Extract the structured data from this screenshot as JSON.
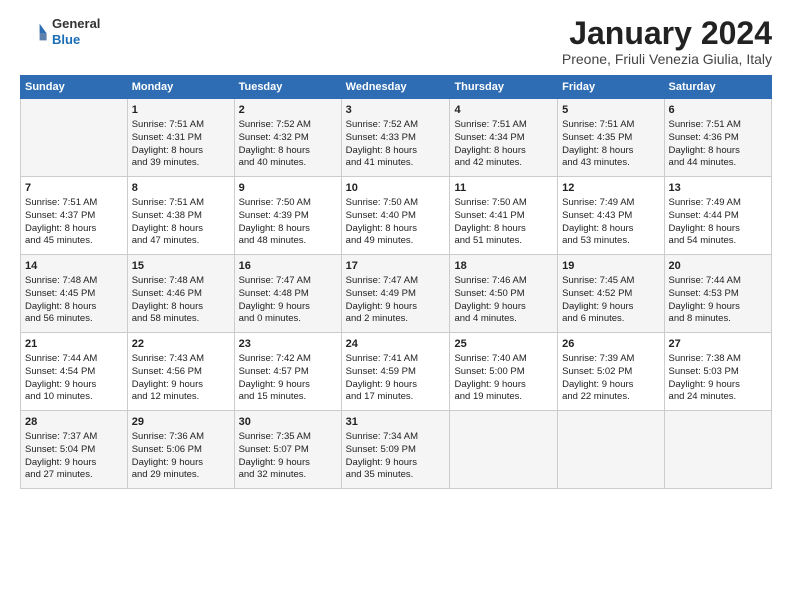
{
  "logo": {
    "general": "General",
    "blue": "Blue"
  },
  "title": "January 2024",
  "subtitle": "Preone, Friuli Venezia Giulia, Italy",
  "days_header": [
    "Sunday",
    "Monday",
    "Tuesday",
    "Wednesday",
    "Thursday",
    "Friday",
    "Saturday"
  ],
  "weeks": [
    [
      {
        "day": "",
        "content": ""
      },
      {
        "day": "1",
        "content": "Sunrise: 7:51 AM\nSunset: 4:31 PM\nDaylight: 8 hours\nand 39 minutes."
      },
      {
        "day": "2",
        "content": "Sunrise: 7:52 AM\nSunset: 4:32 PM\nDaylight: 8 hours\nand 40 minutes."
      },
      {
        "day": "3",
        "content": "Sunrise: 7:52 AM\nSunset: 4:33 PM\nDaylight: 8 hours\nand 41 minutes."
      },
      {
        "day": "4",
        "content": "Sunrise: 7:51 AM\nSunset: 4:34 PM\nDaylight: 8 hours\nand 42 minutes."
      },
      {
        "day": "5",
        "content": "Sunrise: 7:51 AM\nSunset: 4:35 PM\nDaylight: 8 hours\nand 43 minutes."
      },
      {
        "day": "6",
        "content": "Sunrise: 7:51 AM\nSunset: 4:36 PM\nDaylight: 8 hours\nand 44 minutes."
      }
    ],
    [
      {
        "day": "7",
        "content": "Sunrise: 7:51 AM\nSunset: 4:37 PM\nDaylight: 8 hours\nand 45 minutes."
      },
      {
        "day": "8",
        "content": "Sunrise: 7:51 AM\nSunset: 4:38 PM\nDaylight: 8 hours\nand 47 minutes."
      },
      {
        "day": "9",
        "content": "Sunrise: 7:50 AM\nSunset: 4:39 PM\nDaylight: 8 hours\nand 48 minutes."
      },
      {
        "day": "10",
        "content": "Sunrise: 7:50 AM\nSunset: 4:40 PM\nDaylight: 8 hours\nand 49 minutes."
      },
      {
        "day": "11",
        "content": "Sunrise: 7:50 AM\nSunset: 4:41 PM\nDaylight: 8 hours\nand 51 minutes."
      },
      {
        "day": "12",
        "content": "Sunrise: 7:49 AM\nSunset: 4:43 PM\nDaylight: 8 hours\nand 53 minutes."
      },
      {
        "day": "13",
        "content": "Sunrise: 7:49 AM\nSunset: 4:44 PM\nDaylight: 8 hours\nand 54 minutes."
      }
    ],
    [
      {
        "day": "14",
        "content": "Sunrise: 7:48 AM\nSunset: 4:45 PM\nDaylight: 8 hours\nand 56 minutes."
      },
      {
        "day": "15",
        "content": "Sunrise: 7:48 AM\nSunset: 4:46 PM\nDaylight: 8 hours\nand 58 minutes."
      },
      {
        "day": "16",
        "content": "Sunrise: 7:47 AM\nSunset: 4:48 PM\nDaylight: 9 hours\nand 0 minutes."
      },
      {
        "day": "17",
        "content": "Sunrise: 7:47 AM\nSunset: 4:49 PM\nDaylight: 9 hours\nand 2 minutes."
      },
      {
        "day": "18",
        "content": "Sunrise: 7:46 AM\nSunset: 4:50 PM\nDaylight: 9 hours\nand 4 minutes."
      },
      {
        "day": "19",
        "content": "Sunrise: 7:45 AM\nSunset: 4:52 PM\nDaylight: 9 hours\nand 6 minutes."
      },
      {
        "day": "20",
        "content": "Sunrise: 7:44 AM\nSunset: 4:53 PM\nDaylight: 9 hours\nand 8 minutes."
      }
    ],
    [
      {
        "day": "21",
        "content": "Sunrise: 7:44 AM\nSunset: 4:54 PM\nDaylight: 9 hours\nand 10 minutes."
      },
      {
        "day": "22",
        "content": "Sunrise: 7:43 AM\nSunset: 4:56 PM\nDaylight: 9 hours\nand 12 minutes."
      },
      {
        "day": "23",
        "content": "Sunrise: 7:42 AM\nSunset: 4:57 PM\nDaylight: 9 hours\nand 15 minutes."
      },
      {
        "day": "24",
        "content": "Sunrise: 7:41 AM\nSunset: 4:59 PM\nDaylight: 9 hours\nand 17 minutes."
      },
      {
        "day": "25",
        "content": "Sunrise: 7:40 AM\nSunset: 5:00 PM\nDaylight: 9 hours\nand 19 minutes."
      },
      {
        "day": "26",
        "content": "Sunrise: 7:39 AM\nSunset: 5:02 PM\nDaylight: 9 hours\nand 22 minutes."
      },
      {
        "day": "27",
        "content": "Sunrise: 7:38 AM\nSunset: 5:03 PM\nDaylight: 9 hours\nand 24 minutes."
      }
    ],
    [
      {
        "day": "28",
        "content": "Sunrise: 7:37 AM\nSunset: 5:04 PM\nDaylight: 9 hours\nand 27 minutes."
      },
      {
        "day": "29",
        "content": "Sunrise: 7:36 AM\nSunset: 5:06 PM\nDaylight: 9 hours\nand 29 minutes."
      },
      {
        "day": "30",
        "content": "Sunrise: 7:35 AM\nSunset: 5:07 PM\nDaylight: 9 hours\nand 32 minutes."
      },
      {
        "day": "31",
        "content": "Sunrise: 7:34 AM\nSunset: 5:09 PM\nDaylight: 9 hours\nand 35 minutes."
      },
      {
        "day": "",
        "content": ""
      },
      {
        "day": "",
        "content": ""
      },
      {
        "day": "",
        "content": ""
      }
    ]
  ]
}
